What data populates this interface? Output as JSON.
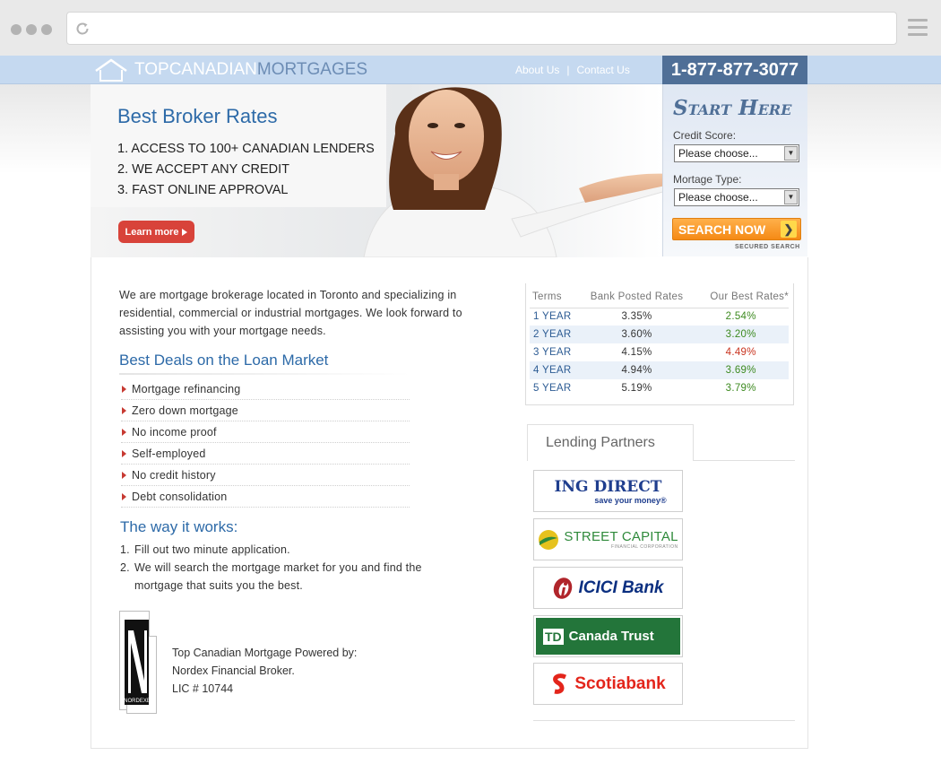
{
  "header": {
    "logo_part1": "TOPCANADIAN",
    "logo_part2": "MORTGAGES",
    "links": [
      "About Us",
      "Contact Us"
    ],
    "separator": "|",
    "phone": "1-877-877-3077"
  },
  "hero": {
    "title": "Best  Broker Rates",
    "points": [
      "1. ACCESS TO 100+ CANADIAN LENDERS",
      "2. WE ACCEPT ANY CREDIT",
      "3. FAST ONLINE APPROVAL"
    ],
    "learn_more": "Learn more"
  },
  "start_here": {
    "title": "Start Here",
    "credit_label": "Credit Score:",
    "credit_value": "Please choose...",
    "mortgage_label": "Mortage Type:",
    "mortgage_value": "Please choose...",
    "search_button": "SEARCH NOW",
    "secured": "SECURED SEARCH"
  },
  "intro": "We are mortgage brokerage located in Toronto and specializing in residential, commercial or industrial mortgages. We look forward to assisting you with your mortgage needs.",
  "deals": {
    "title": "Best Deals on the Loan Market",
    "items": [
      "Mortgage refinancing",
      "Zero down mortgage",
      "No income proof",
      "Self-employed",
      "No credit history",
      "Debt consolidation"
    ]
  },
  "how": {
    "title": "The way it works:",
    "steps": [
      {
        "num": "1.",
        "text": "Fill out two minute application."
      },
      {
        "num": "2.",
        "text": "We will search the mortgage market for you and find the mortgage that suits you the best."
      }
    ]
  },
  "powered": {
    "logo_text": "NORDEXE",
    "lines": [
      "Top Canadian Mortgage Powered by:",
      "Nordex Financial Broker.",
      "LIC # 10744"
    ]
  },
  "rates": {
    "headers": [
      "Terms",
      "Bank Posted Rates",
      "Our Best Rates*"
    ],
    "rows": [
      {
        "term": "1 YEAR",
        "bank": "3.35%",
        "best": "2.54%"
      },
      {
        "term": "2 YEAR",
        "bank": "3.60%",
        "best": "3.20%"
      },
      {
        "term": "3 YEAR",
        "bank": "4.15%",
        "best": "4.49%"
      },
      {
        "term": "4 YEAR",
        "bank": "4.94%",
        "best": "3.69%"
      },
      {
        "term": "5 YEAR",
        "bank": "5.19%",
        "best": "3.79%"
      }
    ]
  },
  "partners": {
    "title": "Lending Partners",
    "ing_name": "ING DIRECT",
    "ing_tag": "save your money®",
    "street_name": "STREET CAPITAL",
    "street_sub": "FINANCIAL CORPORATION",
    "icici_name": "ICICI Bank",
    "td_mark": "TD",
    "td_name": "Canada Trust",
    "scotia_name": "Scotiabank"
  },
  "colors": {
    "band": "#c5d9f0",
    "phone_bg": "#4f6f97",
    "accent_blue": "#2d6aa8",
    "cta_red": "#d8433a",
    "cta_orange": "#f58a15",
    "rate_good": "#3d8a20",
    "rate_warn": "#c9341f"
  },
  "icons": [
    "reload-icon",
    "menu-icon",
    "house-logo-icon",
    "play-icon",
    "chevron-right-icon",
    "triangle-bullet-icon"
  ]
}
